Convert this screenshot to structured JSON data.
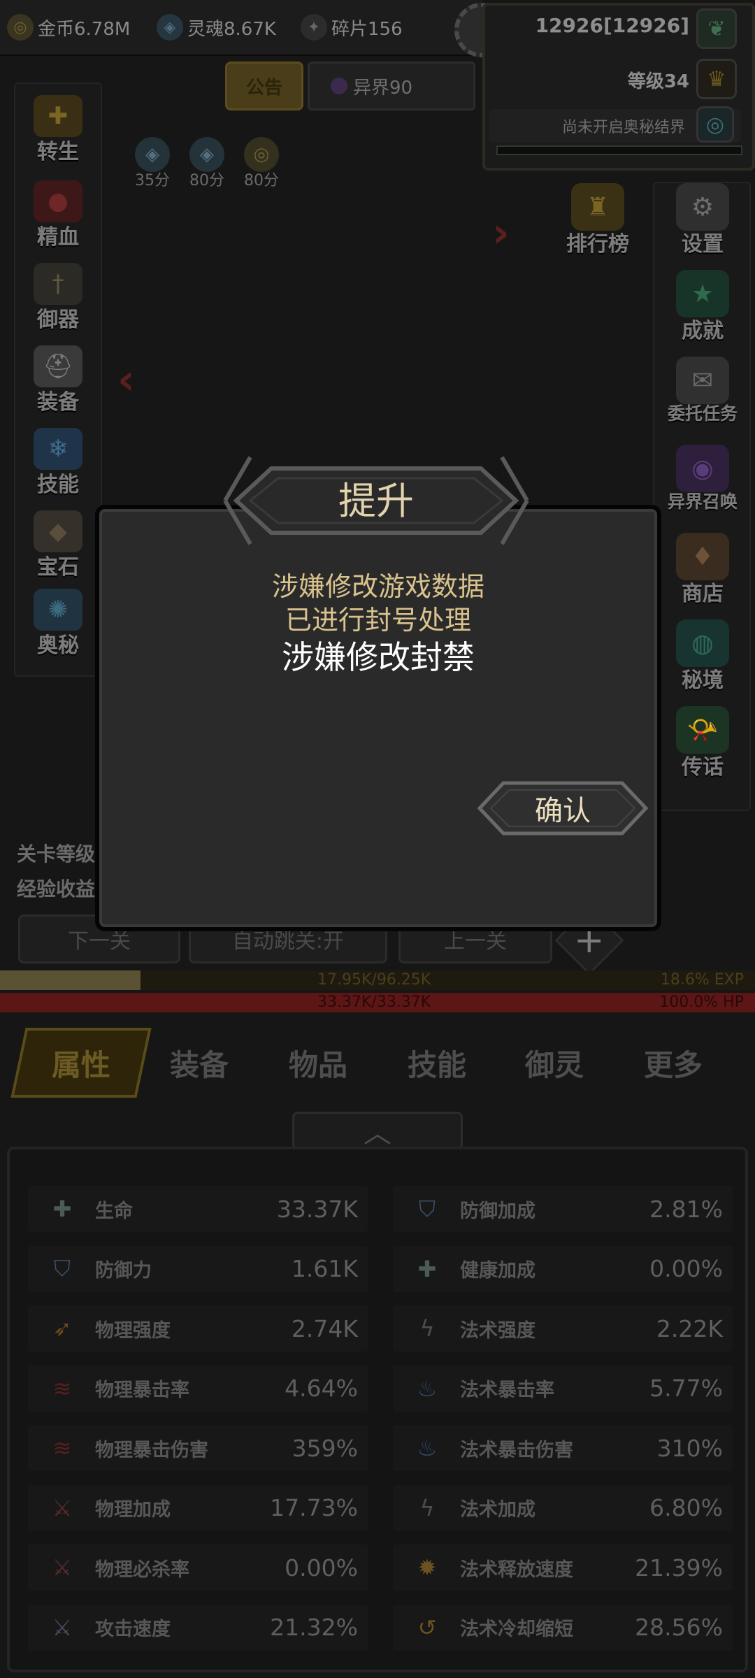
{
  "resources": {
    "gold": "金币6.78M",
    "soul": "灵魂8.67K",
    "shard": "碎片156"
  },
  "player": {
    "id_text": "12926[12926]",
    "level": "等级34",
    "ancient_realm": "尚未开启奥秘结界"
  },
  "notice_label": "公告",
  "world_tab": "异界90",
  "boosts": [
    "35分",
    "80分",
    "80分"
  ],
  "left_menu": [
    "转生",
    "精血",
    "御器",
    "装备",
    "技能",
    "宝石",
    "奥秘"
  ],
  "right_menu": [
    "设置",
    "成就",
    "委托任务",
    "异界召唤",
    "商店",
    "秘境",
    "传话"
  ],
  "rank_label": "排行榜",
  "stage_info": [
    "关卡等级",
    "经验收益"
  ],
  "stage_buttons": [
    "下一关",
    "自动跳关:开",
    "上一关"
  ],
  "exp_bar": {
    "value": "17.95K/96.25K",
    "percent": "18.6% EXP",
    "fill_fraction": 0.186
  },
  "hp_bar": {
    "value": "33.37K/33.37K",
    "percent": "100.0%  HP",
    "fill_fraction": 1.0
  },
  "tabs": [
    "属性",
    "装备",
    "物品",
    "技能",
    "御灵",
    "更多"
  ],
  "collapse_icon": "chevron-up-icon",
  "stats_left": [
    {
      "name": "生命",
      "value": "33.37K",
      "icon": "cross-icon",
      "color": "#4a5c55"
    },
    {
      "name": "防御力",
      "value": "1.61K",
      "icon": "shield-icon",
      "color": "#3d4f66"
    },
    {
      "name": "物理强度",
      "value": "2.74K",
      "icon": "wing-icon",
      "color": "#6b4a1e"
    },
    {
      "name": "物理暴击率",
      "value": "4.64%",
      "icon": "claw-icon",
      "color": "#5a1e1e"
    },
    {
      "name": "物理暴击伤害",
      "value": "359%",
      "icon": "claw-icon",
      "color": "#5a1e1e"
    },
    {
      "name": "物理加成",
      "value": "17.73%",
      "icon": "slash-icon",
      "color": "#5a2a2a"
    },
    {
      "name": "物理必杀率",
      "value": "0.00%",
      "icon": "slash-icon",
      "color": "#5a2a2a"
    },
    {
      "name": "攻击速度",
      "value": "21.32%",
      "icon": "swords-icon",
      "color": "#4c4c5e"
    }
  ],
  "stats_right": [
    {
      "name": "防御加成",
      "value": "2.81%",
      "icon": "shield-icon",
      "color": "#3d4f66"
    },
    {
      "name": "健康加成",
      "value": "0.00%",
      "icon": "cross-icon",
      "color": "#4a5c55"
    },
    {
      "name": "法术强度",
      "value": "2.22K",
      "icon": "lightning-icon",
      "color": "#4d4d4d"
    },
    {
      "name": "法术暴击率",
      "value": "5.77%",
      "icon": "blue-flame-icon",
      "color": "#2e4a6e"
    },
    {
      "name": "法术暴击伤害",
      "value": "310%",
      "icon": "blue-flame-icon",
      "color": "#2e4a6e"
    },
    {
      "name": "法术加成",
      "value": "6.80%",
      "icon": "lightning-icon",
      "color": "#4d4d4d"
    },
    {
      "name": "法术释放速度",
      "value": "21.39%",
      "icon": "gold-burst-icon",
      "color": "#6b5220"
    },
    {
      "name": "法术冷却缩短",
      "value": "28.56%",
      "icon": "swirl-icon",
      "color": "#6b5220"
    }
  ],
  "modal": {
    "title": "提升",
    "line1": "涉嫌修改游戏数据",
    "line2": "已进行封号处理",
    "strong": "涉嫌修改封禁",
    "confirm": "确认"
  }
}
